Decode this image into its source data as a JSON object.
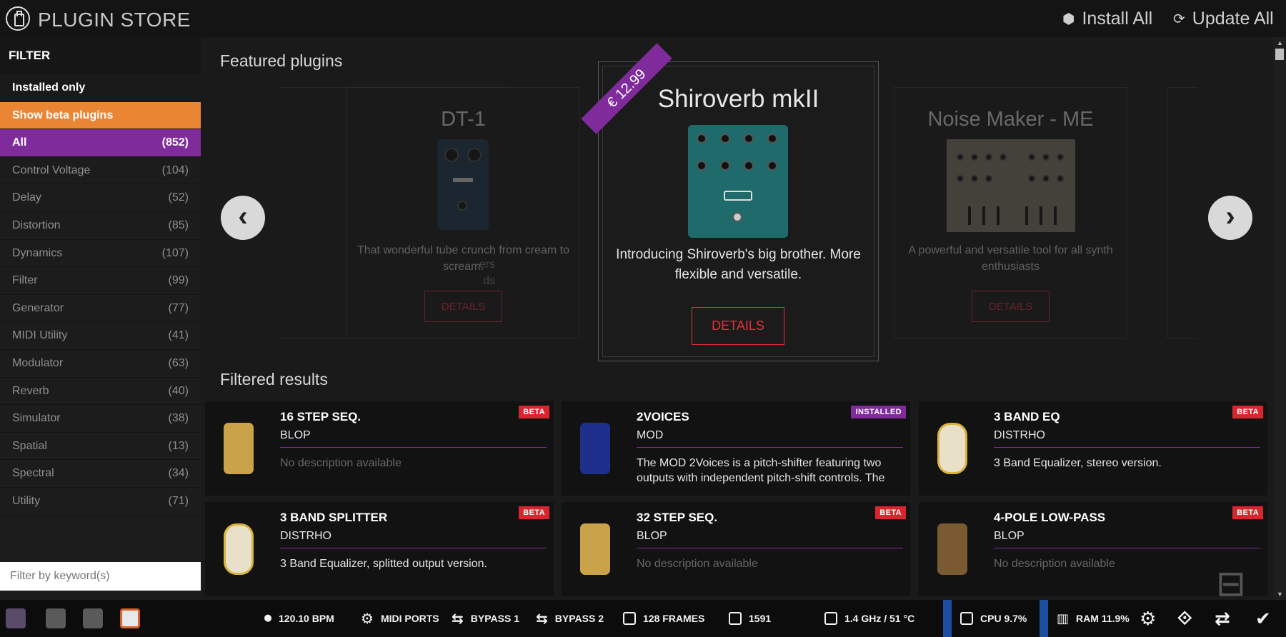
{
  "header": {
    "title": "PLUGIN STORE",
    "install_all": "Install All",
    "update_all": "Update All"
  },
  "sidebar": {
    "title": "FILTER",
    "installed_only": "Installed only",
    "show_beta": "Show beta plugins",
    "categories": [
      {
        "label": "All",
        "count": "(852)"
      },
      {
        "label": "Control Voltage",
        "count": "(104)"
      },
      {
        "label": "Delay",
        "count": "(52)"
      },
      {
        "label": "Distortion",
        "count": "(85)"
      },
      {
        "label": "Dynamics",
        "count": "(107)"
      },
      {
        "label": "Filter",
        "count": "(99)"
      },
      {
        "label": "Generator",
        "count": "(77)"
      },
      {
        "label": "MIDI Utility",
        "count": "(41)"
      },
      {
        "label": "Modulator",
        "count": "(63)"
      },
      {
        "label": "Reverb",
        "count": "(40)"
      },
      {
        "label": "Simulator",
        "count": "(38)"
      },
      {
        "label": "Spatial",
        "count": "(13)"
      },
      {
        "label": "Spectral",
        "count": "(34)"
      },
      {
        "label": "Utility",
        "count": "(71)"
      }
    ],
    "keyword_placeholder": "Filter by keyword(s)"
  },
  "featured": {
    "heading": "Featured plugins",
    "partial_left_text": "ers\nds",
    "cards": [
      {
        "name": "DT-1",
        "description": "That wonderful tube crunch from cream to scream.",
        "details": "DETAILS"
      },
      {
        "name": "Shiroverb mkII",
        "price": "€ 12.99",
        "description": "Introducing Shiroverb's big brother. More flexible and versatile.",
        "details": "DETAILS"
      },
      {
        "name": "Noise Maker - ME",
        "description": "A powerful and versatile tool for all synth enthusiasts",
        "details": "DETAILS"
      }
    ]
  },
  "results": {
    "heading": "Filtered results",
    "items": [
      {
        "name": "16 STEP SEQ.",
        "brand": "BLOP",
        "description": "No description available",
        "badge": "BETA"
      },
      {
        "name": "2VOICES",
        "brand": "MOD",
        "description": "The MOD 2Voices is a pitch-shifter featuring two outputs with independent pitch-shift controls. The",
        "badge": "INSTALLED"
      },
      {
        "name": "3 BAND EQ",
        "brand": "DISTRHO",
        "description": "3 Band Equalizer, stereo version.",
        "badge": "BETA"
      },
      {
        "name": "3 BAND SPLITTER",
        "brand": "DISTRHO",
        "description": "3 Band Equalizer, splitted output version.",
        "badge": "BETA"
      },
      {
        "name": "32 STEP SEQ.",
        "brand": "BLOP",
        "description": "No description available",
        "badge": "BETA"
      },
      {
        "name": "4-POLE LOW-PASS",
        "brand": "BLOP",
        "description": "No description available",
        "badge": "BETA"
      }
    ]
  },
  "footer": {
    "bpm": "120.10 BPM",
    "midi_ports": "MIDI PORTS",
    "bypass1": "BYPASS 1",
    "bypass2": "BYPASS 2",
    "frames": "128 FRAMES",
    "xruns": "1591",
    "cpu_freq": "1.4 GHz / 51 °C",
    "cpu": "CPU 9.7%",
    "ram": "RAM 11.9%"
  },
  "colors": {
    "accent_purple": "#7f2b9c",
    "accent_orange": "#ea8533",
    "beta_red": "#d9252d",
    "details_red": "#e5303a"
  }
}
